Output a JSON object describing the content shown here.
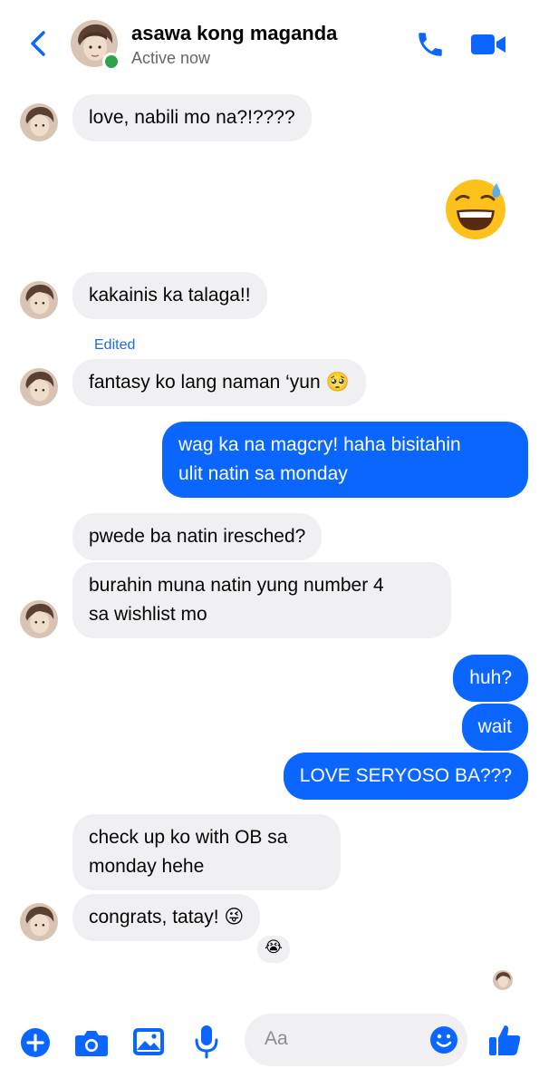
{
  "header": {
    "contact_name": "asawa kong maganda",
    "status": "Active now"
  },
  "messages": [
    {
      "side": "in",
      "text": "love, nabili mo na?!????"
    },
    {
      "side": "out",
      "text": "😅",
      "kind": "emoji"
    },
    {
      "side": "in",
      "text": "kakainis ka talaga!!"
    },
    {
      "side": "in",
      "text": "fantasy ko lang naman ‘yun 🥺",
      "edited_label": "Edited"
    },
    {
      "side": "out",
      "text_lines": [
        "wag ka na magcry! haha bisitahin",
        "ulit natin sa monday"
      ]
    },
    {
      "side": "in",
      "text": "pwede ba natin iresched?"
    },
    {
      "side": "in",
      "text_lines": [
        "burahin muna natin yung number 4",
        "sa wishlist mo"
      ]
    },
    {
      "side": "out",
      "text": "huh?"
    },
    {
      "side": "out",
      "text": "wait"
    },
    {
      "side": "out",
      "text": "LOVE SERYOSO BA???"
    },
    {
      "side": "in",
      "text_lines": [
        "check up ko with OB sa",
        "monday hehe"
      ]
    },
    {
      "side": "in",
      "text": "congrats, tatay! 😜",
      "reaction": "😭"
    }
  ],
  "composer": {
    "placeholder": "Aa"
  },
  "colors": {
    "accent": "#0a66ff",
    "incoming_bubble": "#f0f0f2",
    "online": "#31a24c",
    "edited": "#1a6ed8"
  },
  "icons": {
    "header": [
      "back-chevron-icon",
      "phone-icon",
      "video-camera-icon"
    ],
    "toolbar": [
      "plus-icon",
      "camera-icon",
      "gallery-icon",
      "microphone-icon",
      "smiley-icon",
      "thumbs-up-icon"
    ]
  }
}
